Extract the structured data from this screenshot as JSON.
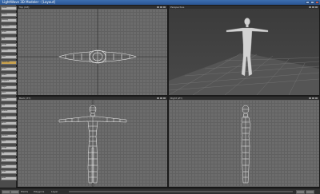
{
  "window": {
    "title": "LightWave 3D Modeler - [Layout]"
  },
  "sidebar": {
    "items": [
      {
        "label": "Create",
        "accent": false
      },
      {
        "label": "Modify",
        "accent": false
      },
      {
        "label": "Multiply",
        "accent": false
      },
      {
        "label": "Construct",
        "accent": false
      },
      {
        "label": "Detail",
        "accent": false
      },
      {
        "label": "Map",
        "accent": false
      },
      {
        "label": "Setup",
        "accent": false
      },
      {
        "label": "Utilities",
        "accent": false
      },
      {
        "label": "View",
        "accent": false
      },
      {
        "label": "Subdivide",
        "accent": true
      },
      {
        "label": "Select",
        "accent": false
      },
      {
        "label": "Points",
        "accent": false
      },
      {
        "label": "Polygons",
        "accent": false
      },
      {
        "label": "Edges",
        "accent": false
      },
      {
        "label": "Move",
        "accent": false
      },
      {
        "label": "Rotate",
        "accent": false
      },
      {
        "label": "Size",
        "accent": false
      },
      {
        "label": "Stretch",
        "accent": false
      },
      {
        "label": "Mirror",
        "accent": false
      },
      {
        "label": "Bevel",
        "accent": false
      },
      {
        "label": "Extrude",
        "accent": false
      },
      {
        "label": "Smooth",
        "accent": false
      },
      {
        "label": "Weld",
        "accent": false
      },
      {
        "label": "Merge",
        "accent": false
      },
      {
        "label": "Cut",
        "accent": false
      },
      {
        "label": "Copy",
        "accent": false
      },
      {
        "label": "Paste",
        "accent": false
      },
      {
        "label": "Undo",
        "accent": false
      },
      {
        "label": "Redo",
        "accent": false
      }
    ]
  },
  "viewports": {
    "top": {
      "label": "Top (XZ)"
    },
    "perspective": {
      "label": "Perspective"
    },
    "back": {
      "label": "Back (XY)"
    },
    "right": {
      "label": "Right (ZY)"
    }
  },
  "bottombar": {
    "points_label": "Points",
    "polygons_label": "Polygons",
    "layer_label": "Layer"
  },
  "colors": {
    "wire": "#f0f0f0",
    "grid_line": "#616161",
    "viewport_bg": "#6c6c6c"
  }
}
